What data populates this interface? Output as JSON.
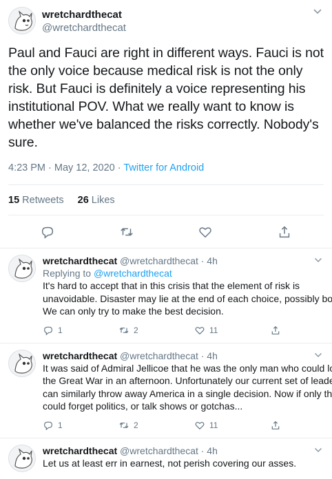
{
  "main_tweet": {
    "display_name": "wretchardthecat",
    "handle": "@wretchardthecat",
    "menu_icon": "chevron-down-icon",
    "text": "Paul and Fauci are right in different ways. Fauci is not the only voice because medical risk is not the only risk. But Fauci is definitely a voice representing his institutional POV. What we really want to know is whether we've balanced the risks correctly. Nobody's sure.",
    "time": "4:23 PM · May 12, 2020 · ",
    "source": "Twitter for Android",
    "retweets_count": "15",
    "retweets_label": "Retweets",
    "likes_count": "26",
    "likes_label": "Likes"
  },
  "replies": [
    {
      "name": "wretchardthecat",
      "handle_time": "@wretchardthecat · 4h",
      "replying_prefix": "Replying to ",
      "replying_to": "@wretchardthecat",
      "text": "It's hard to accept that in this crisis that the element of risk is unavoidable. Disaster may lie at the end of each choice, possibly both. We can only try to make the best decision.",
      "reply_count": "1",
      "retweet_count": "2",
      "like_count": "11"
    },
    {
      "name": "wretchardthecat",
      "handle_time": "@wretchardthecat · 4h",
      "text": "It was said of Admiral Jellicoe that he was the only man who could lose the Great War in an afternoon. Unfortunately our current set of leaders can similarly throw away America in a single decision. Now if only they could forget politics, or talk shows or gotchas...",
      "reply_count": "1",
      "retweet_count": "2",
      "like_count": "11"
    },
    {
      "name": "wretchardthecat",
      "handle_time": "@wretchardthecat · 4h",
      "text": "Let us at least err in earnest, not perish covering our asses."
    }
  ],
  "colors": {
    "accent": "#1da1f2",
    "muted": "#657786",
    "border": "#e6ecf0"
  }
}
